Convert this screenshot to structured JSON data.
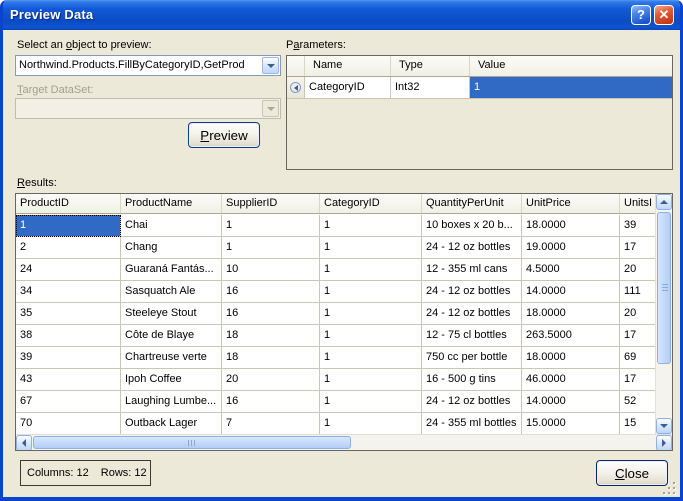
{
  "window": {
    "title": "Preview Data",
    "help_icon": "?",
    "close_icon": "✕"
  },
  "left_panel": {
    "select_label": {
      "pre": "Select an ",
      "key": "o",
      "post": "bject to preview:"
    },
    "object_combo": {
      "value": "Northwind.Products.FillByCategoryID,GetProd"
    },
    "target_label": {
      "pre": "",
      "key": "T",
      "post": "arget DataSet:"
    },
    "target_combo": {
      "value": ""
    },
    "preview_button": {
      "pre": "",
      "key": "P",
      "post": "review"
    }
  },
  "parameters": {
    "label": {
      "pre": "P",
      "key": "a",
      "post": "rameters:"
    },
    "columns": [
      "Name",
      "Type",
      "Value"
    ],
    "row": {
      "icon": "input-arrow-circle-icon",
      "name": "CategoryID",
      "type": "Int32",
      "value": "1"
    }
  },
  "results": {
    "label": {
      "pre": "",
      "key": "R",
      "post": "esults:"
    },
    "columns": [
      "ProductID",
      "ProductName",
      "SupplierID",
      "CategoryID",
      "QuantityPerUnit",
      "UnitPrice",
      "UnitsI"
    ],
    "rows": [
      [
        "1",
        "Chai",
        "1",
        "1",
        "10 boxes x 20 b...",
        "18.0000",
        "39"
      ],
      [
        "2",
        "Chang",
        "1",
        "1",
        "24 - 12 oz bottles",
        "19.0000",
        "17"
      ],
      [
        "24",
        "Guaraná Fantás...",
        "10",
        "1",
        "12 - 355 ml cans",
        "4.5000",
        "20"
      ],
      [
        "34",
        "Sasquatch Ale",
        "16",
        "1",
        "24 - 12 oz bottles",
        "14.0000",
        "111"
      ],
      [
        "35",
        "Steeleye Stout",
        "16",
        "1",
        "24 - 12 oz bottles",
        "18.0000",
        "20"
      ],
      [
        "38",
        "Côte de Blaye",
        "18",
        "1",
        "12 - 75 cl bottles",
        "263.5000",
        "17"
      ],
      [
        "39",
        "Chartreuse verte",
        "18",
        "1",
        "750 cc per bottle",
        "18.0000",
        "69"
      ],
      [
        "43",
        "Ipoh Coffee",
        "20",
        "1",
        "16 - 500 g tins",
        "46.0000",
        "17"
      ],
      [
        "67",
        "Laughing Lumbe...",
        "16",
        "1",
        "24 - 12 oz bottles",
        "14.0000",
        "52"
      ],
      [
        "70",
        "Outback Lager",
        "7",
        "1",
        "24 - 355 ml bottles",
        "15.0000",
        "15"
      ]
    ],
    "selected_cell": {
      "row": 0,
      "col": 0
    }
  },
  "status": {
    "columns_text": "Columns: 12",
    "rows_text": "Rows: 12"
  },
  "close_button": {
    "pre": "",
    "key": "C",
    "post": "lose"
  },
  "colors": {
    "dialog_background": "#ECE9D8",
    "titlebar_blue": "#1159D6",
    "selection_blue": "#316AC5",
    "close_button_red": "#D64E2A"
  }
}
